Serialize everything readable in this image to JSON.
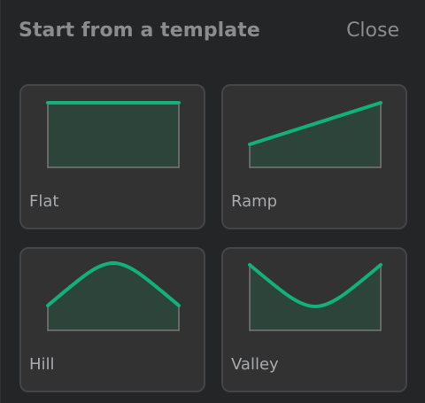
{
  "header": {
    "title": "Start from a template",
    "close_label": "Close"
  },
  "colors": {
    "accent": "#12b07a",
    "fill": "#2c443a",
    "frame": "#777877",
    "card_bg": "#323233",
    "card_border": "#454547",
    "text": "#8b8c8e"
  },
  "templates": [
    {
      "label": "Flat",
      "shape": "flat"
    },
    {
      "label": "Ramp",
      "shape": "ramp"
    },
    {
      "label": "Hill",
      "shape": "hill"
    },
    {
      "label": "Valley",
      "shape": "valley"
    }
  ]
}
